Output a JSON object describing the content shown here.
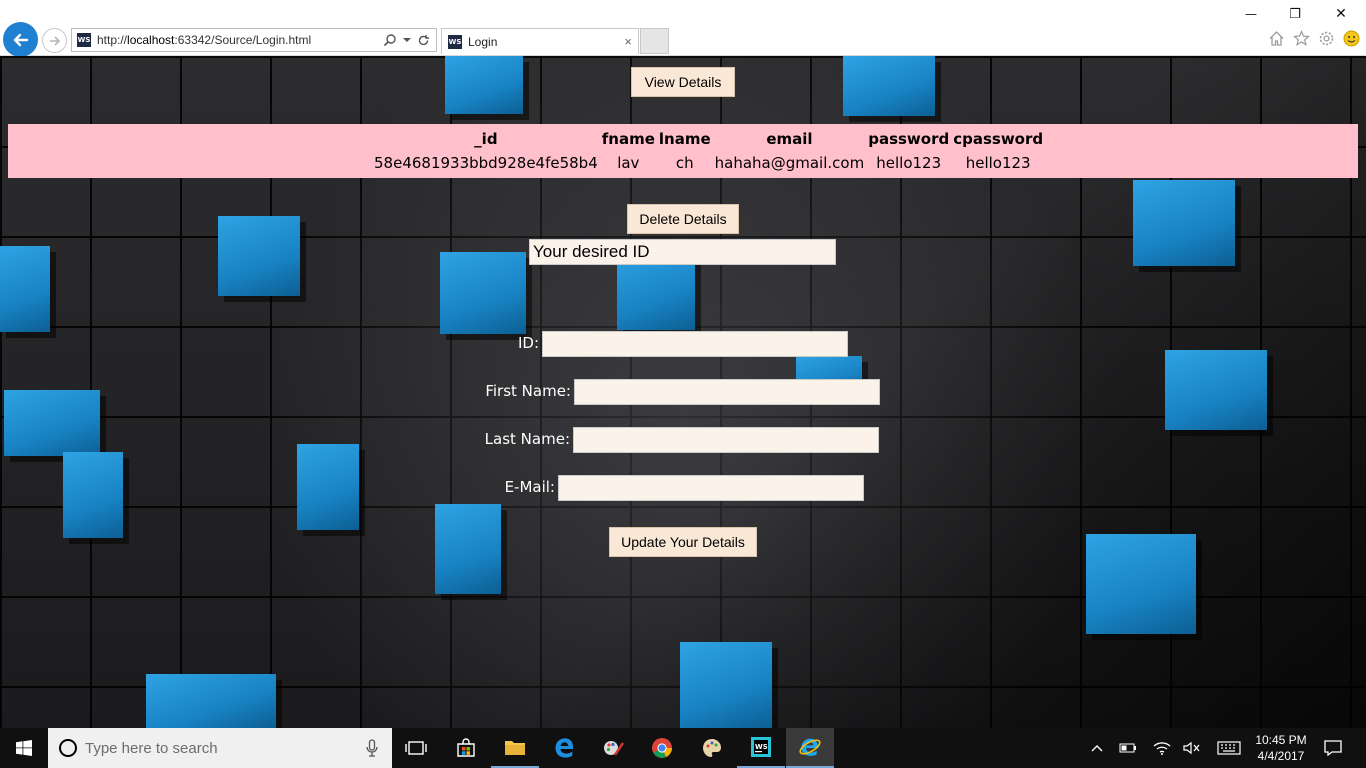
{
  "browser": {
    "url_prefix": "http://",
    "url_host": "localhost",
    "url_rest": ":63342/Source/Login.html",
    "favicon_text": "WS",
    "tab_title": "Login",
    "tab_close": "×",
    "min_glyph": "—",
    "max_glyph": "❐",
    "close_glyph": "✕"
  },
  "page": {
    "view_button": "View Details",
    "table": {
      "headers": [
        "_id",
        "fname",
        "lname",
        "email",
        "password",
        "cpassword"
      ],
      "row": [
        "58e4681933bbd928e4fe58b4",
        "lav",
        "ch",
        "hahaha@gmail.com",
        "hello123",
        "hello123"
      ]
    },
    "delete_button": "Delete Details",
    "desired_id_placeholder": "Your desired ID",
    "labels": {
      "id": "ID:",
      "first_name": "First Name:",
      "last_name": "Last Name:",
      "email": "E-Mail:"
    },
    "update_button": "Update Your Details"
  },
  "taskbar": {
    "search_placeholder": "Type here to search",
    "time": "10:45 PM",
    "date": "4/4/2017"
  },
  "colors": {
    "table_bg": "#ffc0cb",
    "button_bg": "#fae8d6",
    "accent_blue": "#1f7fd1"
  }
}
